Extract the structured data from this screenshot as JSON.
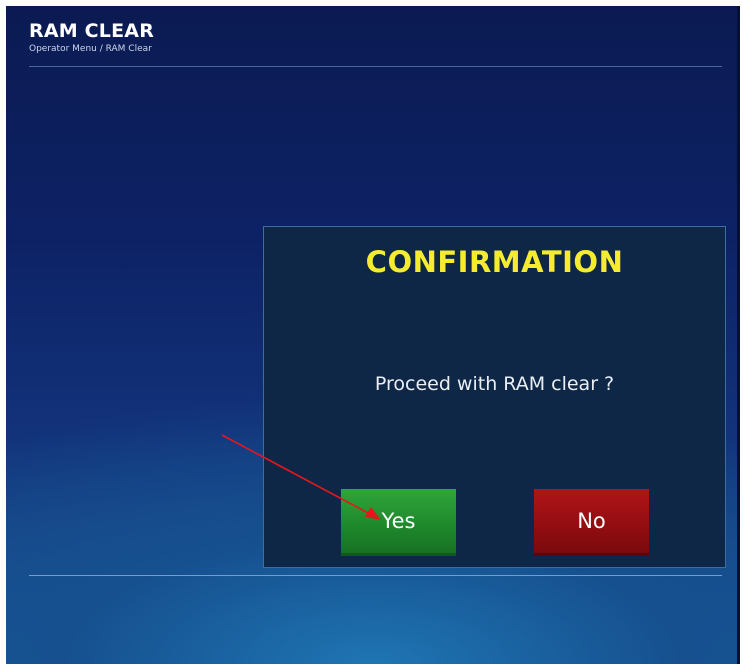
{
  "header": {
    "title": "RAM CLEAR",
    "breadcrumb": "Operator Menu / RAM Clear"
  },
  "dialog": {
    "title": "CONFIRMATION",
    "message": "Proceed with RAM clear ?",
    "yes_label": "Yes",
    "no_label": "No"
  },
  "colors": {
    "title_yellow": "#f5ec2f",
    "yes_green": "#1f8a2c",
    "no_red": "#940e12",
    "annotation_arrow": "#e8161b"
  }
}
